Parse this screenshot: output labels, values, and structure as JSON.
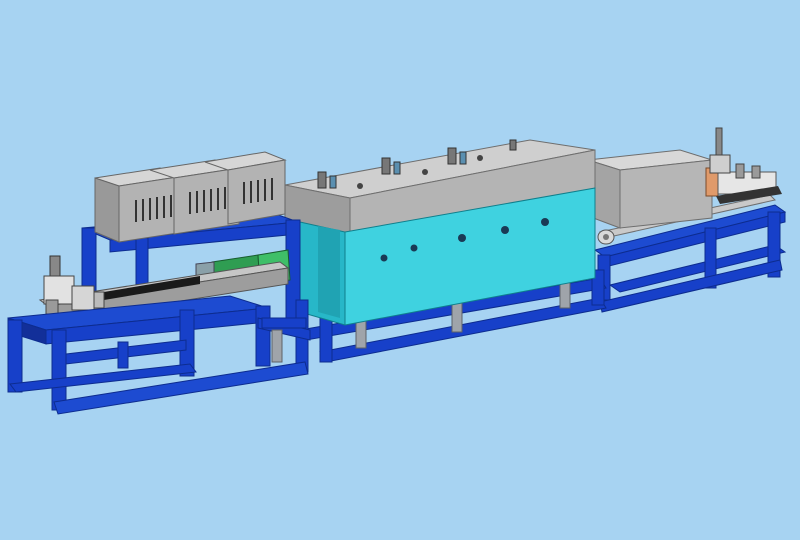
{
  "colors": {
    "background": "#a7d3f2",
    "frame_blue": "#1740c9",
    "frame_blue_dark": "#0d2c8f",
    "furnace_teal": "#3fd2e0",
    "furnace_teal_dark": "#1fa8b8",
    "housing_gray": "#b9b9b9",
    "housing_gray_dark": "#8e8e8e",
    "conveyor_green": "#2f9d52",
    "leg_gray": "#9fa4aa"
  },
  "components": [
    {
      "name": "left-feed-table",
      "icon": "conveyor-frame-icon"
    },
    {
      "name": "transformer-cabinets",
      "icon": "cabinet-icon"
    },
    {
      "name": "induction-coil-section",
      "icon": "coil-icon"
    },
    {
      "name": "heat-treatment-furnace",
      "icon": "furnace-icon"
    },
    {
      "name": "right-cooling-section",
      "icon": "cooling-box-icon"
    },
    {
      "name": "right-discharge-table",
      "icon": "conveyor-frame-icon"
    }
  ]
}
